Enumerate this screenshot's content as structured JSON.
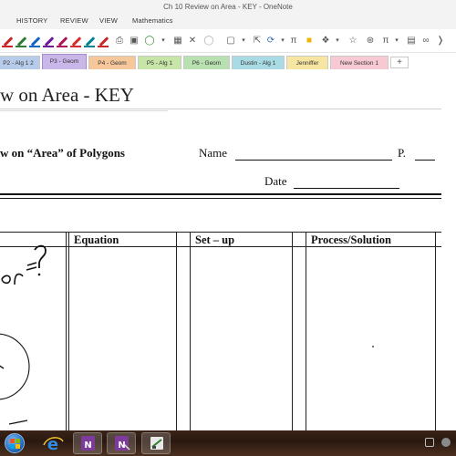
{
  "window": {
    "title": "Ch 10 Review on Area - KEY - OneNote"
  },
  "menu": {
    "items": [
      "HISTORY",
      "REVIEW",
      "VIEW",
      "Mathematics"
    ]
  },
  "toolbar": {
    "pen_colors": [
      "#c62828",
      "#2e7d32",
      "#1565c0",
      "#6a1b9a",
      "#d32f2f",
      "#00838f",
      "#ad1457"
    ]
  },
  "tabs": [
    {
      "label": "P2 - Alg 1 2",
      "color": "#b7cbea"
    },
    {
      "label": "P3 - Geom",
      "color": "#c8b7e8",
      "active": true
    },
    {
      "label": "P4 - Geom",
      "color": "#f6c79a"
    },
    {
      "label": "P5 - Alg 1",
      "color": "#c6e5a6"
    },
    {
      "label": "P6 - Geom",
      "color": "#b9e0b0"
    },
    {
      "label": "Dustin - Alg 1",
      "color": "#a9dbe5"
    },
    {
      "label": "Jenniffer",
      "color": "#f7e6a1"
    },
    {
      "label": "New Section 1",
      "color": "#f7c9d2"
    }
  ],
  "page": {
    "title": "w on Area - KEY",
    "heading": "w on “Area” of Polygons",
    "name_label": "Name",
    "period_label": "P.",
    "date_label": "Date"
  },
  "table": {
    "columns": [
      "Equation",
      "Set – up",
      "Process/Solution"
    ]
  },
  "ink": {
    "handwriting": "or =?",
    "color": "#111111"
  }
}
